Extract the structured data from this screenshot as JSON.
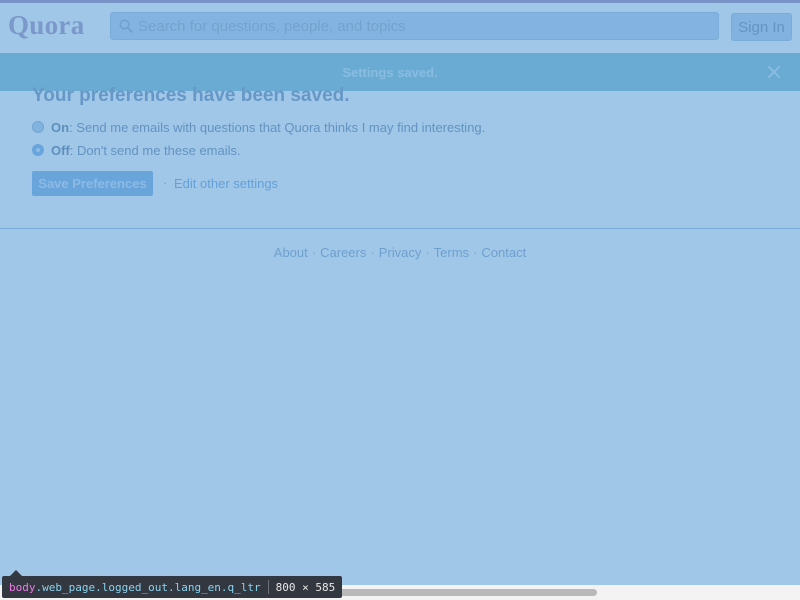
{
  "header": {
    "logo": "Quora",
    "search_placeholder": "Search for questions, people, and topics",
    "signin_label": "Sign In"
  },
  "notice": {
    "text": "Settings saved."
  },
  "main": {
    "heading": "Your preferences have been saved.",
    "options": [
      {
        "key": "On",
        "text": ": Send me emails with questions that Quora thinks I may find interesting.",
        "checked": false
      },
      {
        "key": "Off",
        "text": ": Don't send me these emails.",
        "checked": true
      }
    ],
    "save_label": "Save Preferences",
    "separator": "·",
    "edit_link": "Edit other settings"
  },
  "footer": {
    "links": [
      "About",
      "Careers",
      "Privacy",
      "Terms",
      "Contact"
    ],
    "separator": "·"
  },
  "devtools": {
    "tag": "body",
    "classes": ".web_page.logged_out.lang_en.q_ltr",
    "size": "800 × 585"
  },
  "colors": {
    "overlay": "#6fa8dc",
    "brand": "#8f7aa3",
    "notice_bar": "#61b0c0",
    "primary_button": "#5e9fd9"
  },
  "icons": [
    "search-icon",
    "close-icon"
  ]
}
